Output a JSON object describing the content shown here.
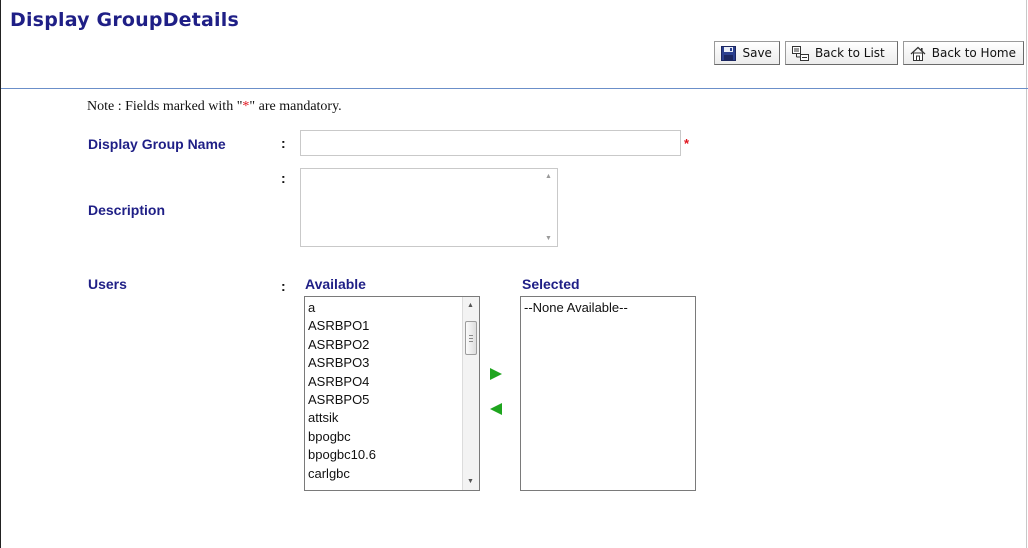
{
  "page": {
    "title": "Display GroupDetails"
  },
  "toolbar": {
    "save_label": "Save",
    "back_to_list_label": "Back to List",
    "back_to_home_label": "Back to Home"
  },
  "note": {
    "prefix": "Note : Fields marked with \"",
    "star": "*",
    "suffix": "\" are mandatory."
  },
  "form": {
    "colon": ":",
    "required_marker": "*",
    "display_group_name": {
      "label": "Display Group Name",
      "value": ""
    },
    "description": {
      "label": "Description",
      "value": ""
    },
    "users": {
      "label": "Users",
      "available_header": "Available",
      "selected_header": "Selected",
      "available_items": [
        "a",
        "ASRBPO1",
        "ASRBPO2",
        "ASRBPO3",
        "ASRBPO4",
        "ASRBPO5",
        "attsik",
        "bpogbc",
        "bpogbc10.6",
        "carlgbc"
      ],
      "selected_items": [
        "--None Available--"
      ]
    }
  },
  "colors": {
    "title": "#1f1f86",
    "label": "#1f1f86",
    "required": "#e0121b",
    "move_arrow": "#1ea51e",
    "rule": "#6b8fc9"
  },
  "icons": {
    "save": "floppy-disk-icon",
    "back_to_list": "list-icon",
    "back_to_home": "house-icon",
    "move_right": "triangle-right-icon",
    "move_left": "triangle-left-icon"
  }
}
